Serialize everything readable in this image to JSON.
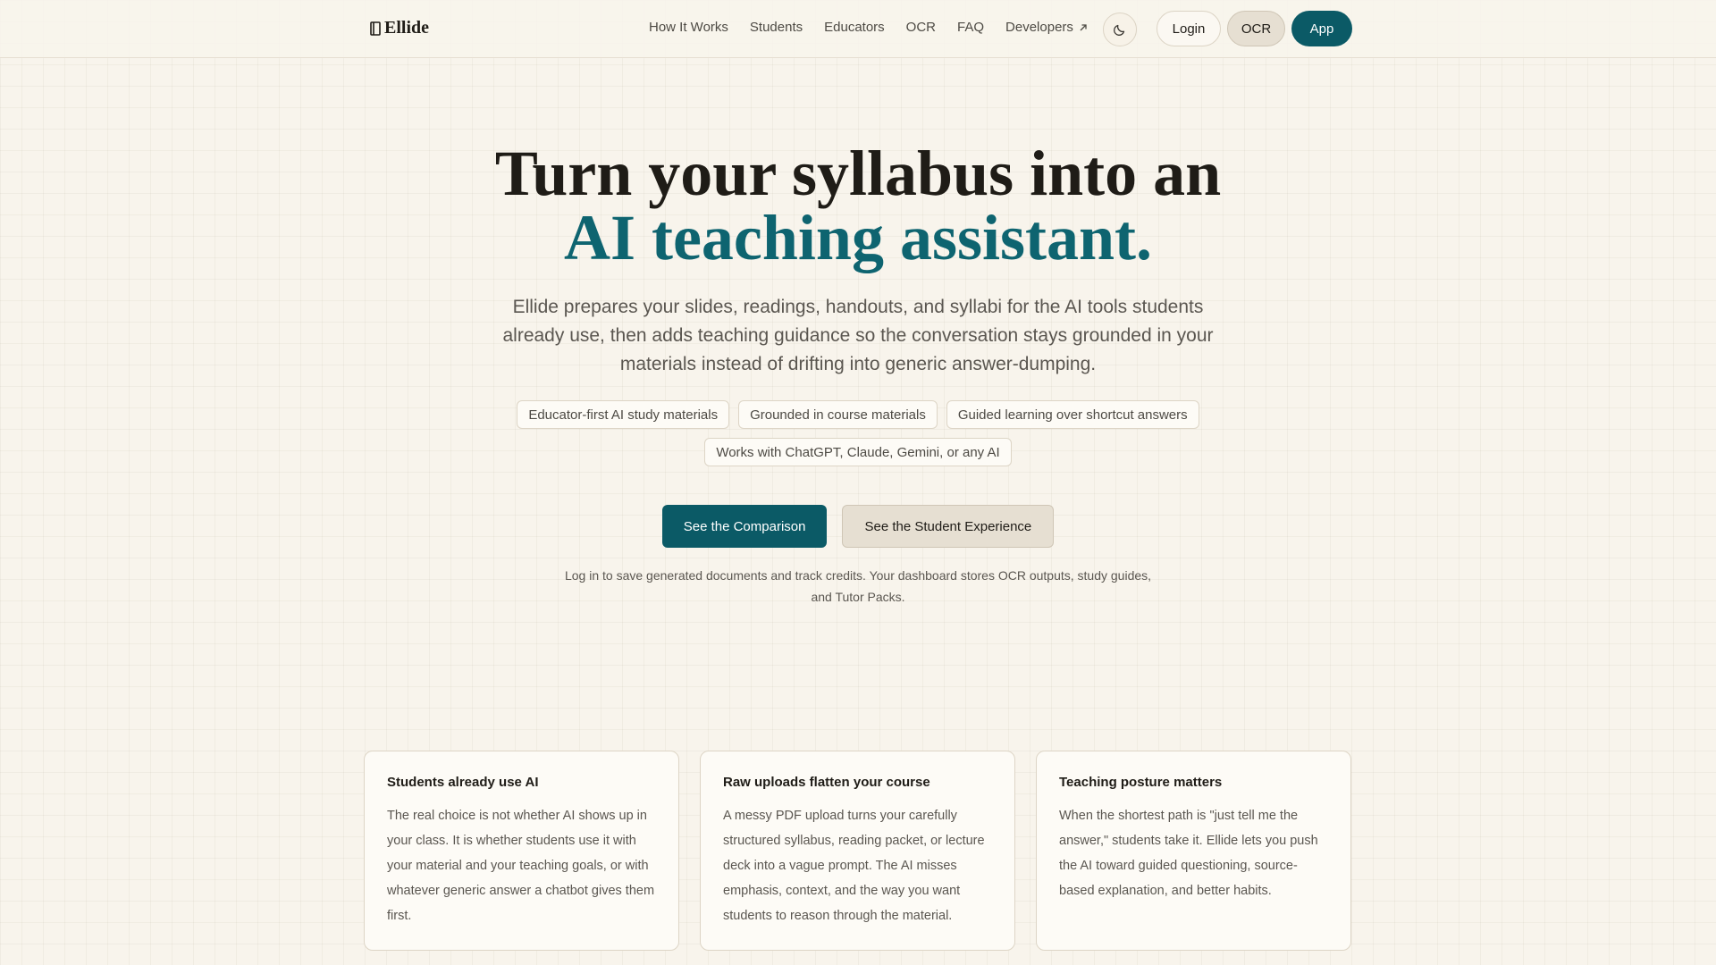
{
  "brand": {
    "name": "Ellide",
    "accent_color": "#0b5a66",
    "logo_icon": "book-icon"
  },
  "nav": {
    "items": [
      {
        "label": "How It Works"
      },
      {
        "label": "Students"
      },
      {
        "label": "Educators"
      },
      {
        "label": "OCR"
      },
      {
        "label": "FAQ"
      },
      {
        "label": "Developers",
        "icon": "external-link-icon"
      }
    ]
  },
  "header_actions": {
    "theme_toggle_icon": "moon-icon",
    "login_label": "Login",
    "ocr_label": "OCR",
    "app_label": "App"
  },
  "hero": {
    "title_line1": "Turn your syllabus into an",
    "title_line2": "AI teaching assistant.",
    "subtitle": "Ellide prepares your slides, readings, handouts, and syllabi for the AI tools students already use, then adds teaching guidance so the conversation stays grounded in your materials instead of drifting into generic answer-dumping.",
    "chips": [
      "Educator-first AI study materials",
      "Grounded in course materials",
      "Guided learning over shortcut answers",
      "Works with ChatGPT, Claude, Gemini, or any AI"
    ],
    "primary_cta": "See the Comparison",
    "secondary_cta": "See the Student Experience",
    "note": "Log in to save generated documents and track credits. Your dashboard stores OCR outputs, study guides, and Tutor Packs."
  },
  "cards": [
    {
      "title": "Students already use AI",
      "body": "The real choice is not whether AI shows up in your class. It is whether students use it with your material and your teaching goals, or with whatever generic answer a chatbot gives them first."
    },
    {
      "title": "Raw uploads flatten your course",
      "body": "A messy PDF upload turns your carefully structured syllabus, reading packet, or lecture deck into a vague prompt. The AI misses emphasis, context, and the way you want students to reason through the material."
    },
    {
      "title": "Teaching posture matters",
      "body": "When the shortest path is \"just tell me the answer,\" students take it. Ellide lets you push the AI toward guided questioning, source-based explanation, and better habits."
    }
  ]
}
